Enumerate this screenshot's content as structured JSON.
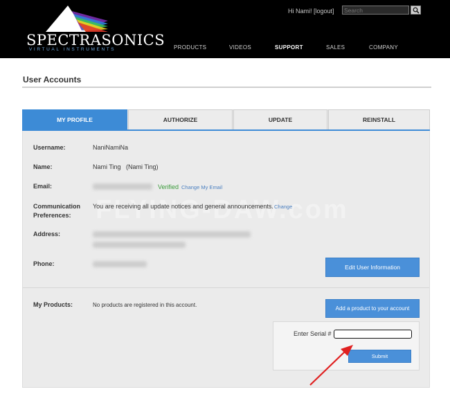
{
  "header": {
    "brand_name": "SPECTRASONICS",
    "brand_sub": "VIRTUAL INSTRUMENTS",
    "greeting": "Hi Nami!",
    "logout": "[logout]",
    "search_placeholder": "Search",
    "nav": [
      "PRODUCTS",
      "VIDEOS",
      "SUPPORT",
      "SALES",
      "COMPANY"
    ],
    "active_nav": "SUPPORT"
  },
  "page": {
    "title": "User Accounts"
  },
  "tabs": [
    "MY PROFILE",
    "AUTHORIZE",
    "UPDATE",
    "REINSTALL"
  ],
  "profile": {
    "username_label": "Username:",
    "username": "NaniNamiNa",
    "name_label": "Name:",
    "name": "Nami Ting   (Nami Ting)",
    "email_label": "Email:",
    "email_status": "Verified",
    "change_email": "Change My Email",
    "comm_label_1": "Communication",
    "comm_label_2": "Preferences:",
    "comm_text": "You are receiving all update notices and general announcements.",
    "comm_change": "Change",
    "address_label": "Address:",
    "phone_label": "Phone:",
    "edit_button": "Edit User Information"
  },
  "products": {
    "label": "My Products:",
    "empty_text": "No products are registered in this account.",
    "add_button": "Add a product to your account",
    "serial_label": "Enter Serial #",
    "submit_button": "Submit"
  },
  "watermark": "FLYING-DAW.com",
  "colors": {
    "accent": "#3d8bd6",
    "verified": "#3a9a3a",
    "arrow": "#e02020"
  }
}
